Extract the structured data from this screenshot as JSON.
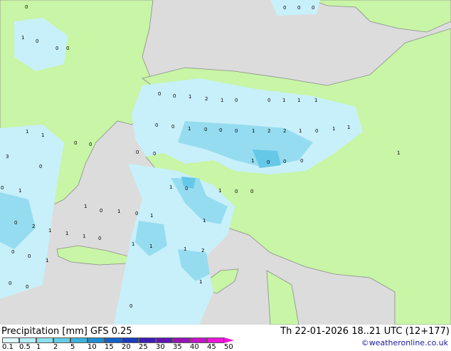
{
  "legend": {
    "title": "Precipitation [mm]",
    "model": "GFS 0.25",
    "datetime": "Th 22-01-2026 18..21 UTC (12+177)",
    "credit": "©weatheronline.co.uk",
    "ticks": [
      "0.1",
      "0.5",
      "1",
      "2",
      "5",
      "10",
      "15",
      "20",
      "25",
      "30",
      "35",
      "40",
      "45",
      "50"
    ],
    "colors": [
      "#dcf8fc",
      "#b4eef8",
      "#8ce0f0",
      "#64cce8",
      "#3cb4e0",
      "#1e8cd2",
      "#1460c8",
      "#1a3cbc",
      "#3c1eb4",
      "#6414b4",
      "#9614b4",
      "#c814c8",
      "#f014dc"
    ]
  },
  "map_colors": {
    "land": "#c8f5a6",
    "sea": "#dcdcdc",
    "coast": "#8c8c8c",
    "precip_light": "#c8f0fa",
    "precip_medium": "#96dcf0",
    "precip_heavy": "#64c8e6"
  },
  "values": [
    "0",
    "0",
    "0",
    "0",
    "1",
    "0",
    "0",
    "0",
    "0",
    "0",
    "1",
    "2",
    "1",
    "0",
    "0",
    "1",
    "1",
    "1",
    "0",
    "0",
    "1",
    "0",
    "0",
    "0",
    "1",
    "2",
    "2",
    "1",
    "0",
    "1",
    "1",
    "1",
    "1",
    "0",
    "0",
    "0",
    "0",
    "1",
    "0",
    "0",
    "0",
    "1",
    "3",
    "0",
    "0",
    "1",
    "1",
    "0",
    "1",
    "0",
    "0",
    "1",
    "0",
    "1",
    "0",
    "1",
    "0",
    "2",
    "1",
    "1",
    "1",
    "0",
    "1",
    "1",
    "1",
    "1",
    "2",
    "0",
    "0",
    "1",
    "0",
    "0",
    "1",
    "0"
  ]
}
